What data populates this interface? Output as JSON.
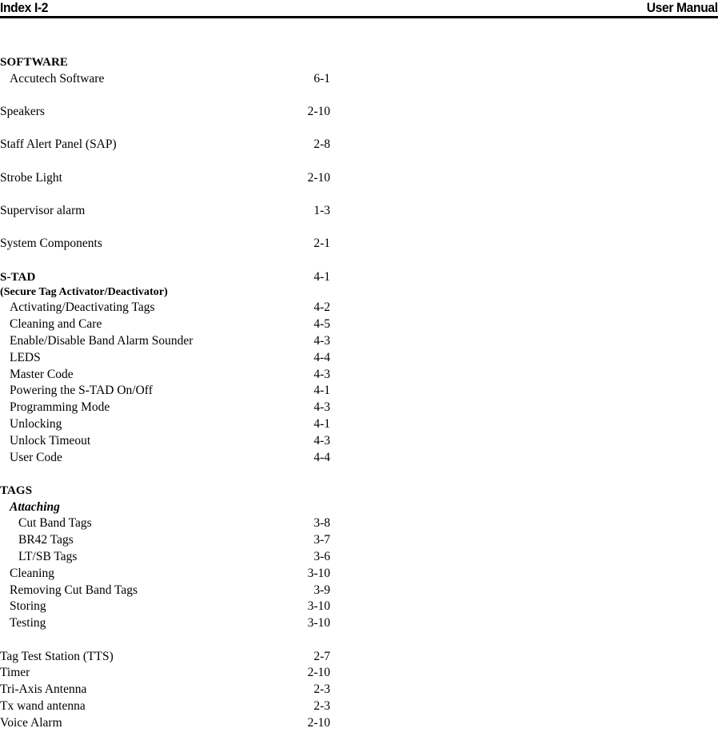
{
  "header": {
    "left": "Index I-2",
    "right": "User Manual"
  },
  "index": {
    "entries": [
      {
        "label": "SOFTWARE",
        "page": "",
        "level": 0,
        "style": "section"
      },
      {
        "label": "Accutech Software",
        "page": "6-1",
        "level": 1,
        "style": "plain"
      },
      {
        "label": "Speakers",
        "page": "2-10",
        "level": 0,
        "style": "plain"
      },
      {
        "label": "Staff Alert Panel (SAP)",
        "page": "2-8",
        "level": 0,
        "style": "plain"
      },
      {
        "label": "Strobe Light",
        "page": "2-10",
        "level": 0,
        "style": "plain"
      },
      {
        "label": "Supervisor alarm",
        "page": "1-3",
        "level": 0,
        "style": "plain"
      },
      {
        "label": "System Components",
        "page": "2-1",
        "level": 0,
        "style": "plain"
      },
      {
        "label": "S-TAD",
        "page": "4-1",
        "level": 0,
        "style": "section"
      },
      {
        "label": "(Secure Tag Activator/Deactivator)",
        "page": "",
        "level": 0,
        "style": "section-sub"
      },
      {
        "label": "Activating/Deactivating Tags",
        "page": "4-2",
        "level": 1,
        "style": "plain"
      },
      {
        "label": "Cleaning and Care",
        "page": "4-5",
        "level": 1,
        "style": "plain"
      },
      {
        "label": "Enable/Disable Band Alarm Sounder",
        "page": "4-3",
        "level": 1,
        "style": "plain"
      },
      {
        "label": "LEDS",
        "page": "4-4",
        "level": 1,
        "style": "plain"
      },
      {
        "label": "Master Code",
        "page": "4-3",
        "level": 1,
        "style": "plain"
      },
      {
        "label": "Powering the S-TAD On/Off",
        "page": "4-1",
        "level": 1,
        "style": "plain"
      },
      {
        "label": "Programming Mode",
        "page": "4-3",
        "level": 1,
        "style": "plain"
      },
      {
        "label": "Unlocking",
        "page": "4-1",
        "level": 1,
        "style": "plain"
      },
      {
        "label": "Unlock Timeout",
        "page": "4-3",
        "level": 1,
        "style": "plain"
      },
      {
        "label": "User Code",
        "page": "4-4",
        "level": 1,
        "style": "plain"
      },
      {
        "label": "TAGS",
        "page": "",
        "level": 0,
        "style": "section"
      },
      {
        "label": "Attaching",
        "page": "",
        "level": 1,
        "style": "subhead"
      },
      {
        "label": "Cut Band Tags",
        "page": "3-8",
        "level": 2,
        "style": "plain"
      },
      {
        "label": "BR42 Tags",
        "page": "3-7",
        "level": 2,
        "style": "plain"
      },
      {
        "label": "LT/SB Tags",
        "page": "3-6",
        "level": 2,
        "style": "plain"
      },
      {
        "label": "Cleaning",
        "page": "3-10",
        "level": 1,
        "style": "plain"
      },
      {
        "label": "Removing Cut Band Tags",
        "page": "3-9",
        "level": 1,
        "style": "plain"
      },
      {
        "label": "Storing",
        "page": "3-10",
        "level": 1,
        "style": "plain"
      },
      {
        "label": "Testing",
        "page": "3-10",
        "level": 1,
        "style": "plain"
      },
      {
        "label": "Tag Test Station (TTS)",
        "page": "2-7",
        "level": 0,
        "style": "plain"
      },
      {
        "label": "Timer",
        "page": "2-10",
        "level": 0,
        "style": "plain"
      },
      {
        "label": "Tri-Axis Antenna",
        "page": "2-3",
        "level": 0,
        "style": "plain"
      },
      {
        "label": "Tx wand antenna",
        "page": "2-3",
        "level": 0,
        "style": "plain"
      },
      {
        "label": "Voice Alarm",
        "page": "2-10",
        "level": 0,
        "style": "plain"
      }
    ],
    "gaps_before": [
      2,
      3,
      4,
      5,
      6,
      7,
      19,
      28
    ]
  }
}
